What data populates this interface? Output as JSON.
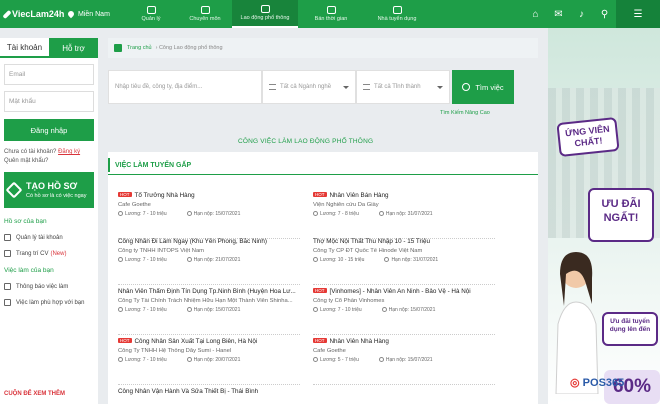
{
  "nav": {
    "logo": "ViecLam24h",
    "region": "Miền Nam",
    "items": [
      {
        "label": "Quản lý"
      },
      {
        "label": "Chuyên môn"
      },
      {
        "label": "Lao động phổ thông"
      },
      {
        "label": "Bán thời gian"
      },
      {
        "label": "Nhà tuyển dụng"
      }
    ],
    "right_icons": [
      "home-icon",
      "chat-icon",
      "bell-icon",
      "search-icon",
      "menu-icon"
    ]
  },
  "sidebar": {
    "tab_account": "Tài khoản",
    "tab_support": "Hỗ trợ",
    "email_placeholder": "Email",
    "password_placeholder": "Mật khẩu",
    "login_button": "Đăng nhập",
    "no_account": "Chưa có tài khoản?",
    "register": "Đăng ký",
    "forgot": "Quên mật khẩu?",
    "cv_title": "TẠO HỒ SƠ",
    "cv_subtitle": "Có hồ sơ là có việc ngay",
    "profile_section": "Hồ sơ của bạn",
    "profile_items": [
      "Quản lý tài khoản",
      "Trang trí CV"
    ],
    "cv_new": "(New)",
    "jobs_section": "Việc làm của bạn",
    "jobs_items": [
      "Thông báo việc làm",
      "Việc làm phù hợp với bạn"
    ],
    "more": "CUỘN ĐỂ XEM THÊM"
  },
  "breadcrumb": {
    "home": "Trang chủ",
    "current": "Công Lao động phổ thông"
  },
  "search": {
    "placeholder": "Nhập tiêu đề, công ty, địa điểm...",
    "category": "Tất cả Ngành nghề",
    "location": "Tất cả Tỉnh thành",
    "button": "Tìm việc",
    "advanced": "Tìm Kiếm Nâng Cao"
  },
  "section_title": "CÔNG VIỆC LÀM LAO ĐỘNG PHỔ THÔNG",
  "urgent_title": "VIỆC LÀM TUYỂN GẤP",
  "labels": {
    "salary": "Lương:",
    "deadline": "Hạn nộp:",
    "hot": "HOT"
  },
  "jobs": [
    {
      "title": "Tổ Trưởng Nhà Hàng",
      "company": "Cafe Goethe",
      "salary": "7 - 10 triệu",
      "deadline": "15/07/2021",
      "hot": true
    },
    {
      "title": "Nhân Viên Bán Hàng",
      "company": "Viện Nghiên cứu Da Giày",
      "salary": "7 - 8 triệu",
      "deadline": "31/07/2021",
      "hot": true
    },
    {
      "title": "Công Nhân Đi Làm Ngay (Khu Yên Phong, Bắc Ninh)",
      "company": "Công ty TNHH INTOPS Việt Nam",
      "salary": "7 - 10 triệu",
      "deadline": "21/07/2021",
      "hot": false
    },
    {
      "title": "Thợ Mộc Nội Thất Thu Nhập 10 - 15 Triệu",
      "company": "Công Ty CP ĐT Quốc Tế Hinode Việt Nam",
      "salary": "10 - 15 triệu",
      "deadline": "31/07/2021",
      "hot": false
    },
    {
      "title": "Nhân Viên Thẩm Định Tín Dụng Tp.Ninh Bình (Huyện Hoa Lư...",
      "company": "Công Ty Tài Chính Trách Nhiệm Hữu Hạn Một Thành Viên Shinha...",
      "salary": "7 - 10 triệu",
      "deadline": "15/07/2021",
      "hot": false
    },
    {
      "title": "[Vinhomes] - Nhân Viên An Ninh - Bảo Vệ - Hà Nội",
      "company": "Công ty Cổ Phần Vinhomes",
      "salary": "7 - 10 triệu",
      "deadline": "15/07/2021",
      "hot": true
    },
    {
      "title": "Công Nhân Sản Xuất Tại Long Biên, Hà Nội",
      "company": "Công Ty TNHH Hệ Thống Dây Sumi - Hanel",
      "salary": "7 - 10 triệu",
      "deadline": "20/07/2021",
      "hot": true
    },
    {
      "title": "Nhân Viên Nhà Hàng",
      "company": "Cafe Goethe",
      "salary": "5 - 7 triệu",
      "deadline": "15/07/2021",
      "hot": true
    },
    {
      "title": "Công Nhân Vận Hành Và Sửa Thiết Bị - Thái Bình",
      "company": "",
      "salary": "",
      "deadline": "",
      "hot": false
    }
  ],
  "ad": {
    "b1": "ỨNG VIÊN CHẤT!",
    "b2": "ƯU ĐÃI NGẤT!",
    "b3": "Ưu đãi tuyển dụng lên đến",
    "pct": "60%",
    "brand": "POS365"
  },
  "colors": {
    "brand_green": "#1e9e48",
    "hot_red": "#e53935",
    "ad_purple": "#5b2a86"
  }
}
